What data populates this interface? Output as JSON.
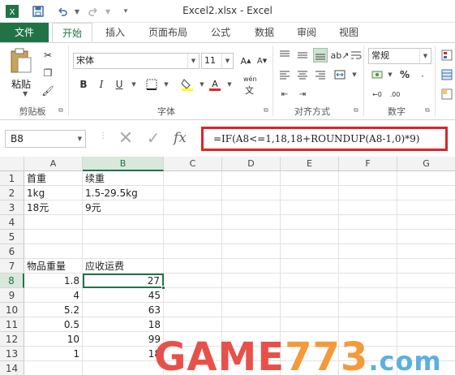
{
  "window": {
    "title": "Excel2.xlsx - Excel"
  },
  "quick_access": {
    "save_icon": "save-icon",
    "undo_icon": "undo-icon",
    "redo_icon": "redo-icon",
    "customize_icon": "dropdown-icon"
  },
  "tabs": [
    "文件",
    "开始",
    "插入",
    "页面布局",
    "公式",
    "数据",
    "审阅",
    "视图"
  ],
  "active_tab": "开始",
  "ribbon": {
    "paste_label": "粘贴",
    "clipboard_label": "剪贴板",
    "font_name": "宋体",
    "font_size": "11",
    "font_group_label": "字体",
    "bold": "B",
    "italic": "I",
    "underline": "U",
    "wen_label": "wén",
    "align_group_label": "对齐方式",
    "number_format": "常规",
    "number_group_label": "数字",
    "percent": "%"
  },
  "formula_bar": {
    "name_box": "B8",
    "fx_label": "fx",
    "formula": "=IF(A8<=1,18,18+ROUNDUP(A8-1,0)*9)"
  },
  "grid": {
    "columns": [
      "A",
      "B",
      "C",
      "D",
      "E",
      "F",
      "G"
    ],
    "selected_column": "B",
    "rows": [
      "1",
      "2",
      "3",
      "4",
      "5",
      "6",
      "7",
      "8",
      "9",
      "10",
      "11",
      "12",
      "13",
      "14"
    ],
    "selected_row": "8",
    "cells": {
      "A1": "首重",
      "B1": "续重",
      "A2": "1kg",
      "B2": "1.5-29.5kg",
      "A3": "18元",
      "B3": "9元",
      "A7": "物品重量",
      "B7": "应收运费",
      "A8": "1.8",
      "B8": "27",
      "A9": "4",
      "B9": "45",
      "A10": "5.2",
      "B10": "63",
      "A11": "0.5",
      "B11": "18",
      "A12": "10",
      "B12": "99",
      "A13": "1",
      "B13": "18"
    }
  },
  "watermark": {
    "text": "GAME773.com",
    "color_game": "#e8504a",
    "color_773": "#f39a3a",
    "color_com": "#5bb0e0"
  },
  "colors": {
    "accent": "#217346",
    "highlight_border": "#d9262b"
  }
}
